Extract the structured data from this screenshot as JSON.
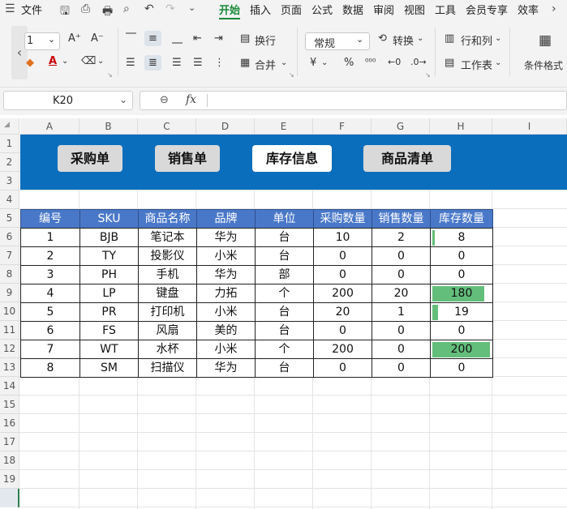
{
  "menu": {
    "file": "文件",
    "tabs": [
      "开始",
      "插入",
      "页面",
      "公式",
      "数据",
      "审阅",
      "视图",
      "工具",
      "会员专享",
      "效率"
    ]
  },
  "ribbon": {
    "font_size_value": "1",
    "wrap": "换行",
    "merge": "合并",
    "number_format": "常规",
    "convert": "转换",
    "rows_cols": "行和列",
    "worksheet": "工作表",
    "conditional_format": "条件格式"
  },
  "formula": {
    "namebox": "K20",
    "fx": "fx",
    "value": ""
  },
  "columns": [
    "A",
    "B",
    "C",
    "D",
    "E",
    "F",
    "G",
    "H",
    "I"
  ],
  "rows": [
    "1",
    "2",
    "3",
    "4",
    "5",
    "6",
    "7",
    "8",
    "9",
    "10",
    "11",
    "12",
    "13",
    "14",
    "15",
    "16",
    "17",
    "18",
    "19",
    "20"
  ],
  "nav_buttons": [
    "采购单",
    "销售单",
    "库存信息",
    "商品清单"
  ],
  "table": {
    "headers": [
      "编号",
      "SKU",
      "商品名称",
      "品牌",
      "单位",
      "采购数量",
      "销售数量",
      "库存数量"
    ],
    "rows": [
      [
        "1",
        "BJB",
        "笔记本",
        "华为",
        "台",
        "10",
        "2",
        "8"
      ],
      [
        "2",
        "TY",
        "投影仪",
        "小米",
        "台",
        "0",
        "0",
        "0"
      ],
      [
        "3",
        "PH",
        "手机",
        "华为",
        "部",
        "0",
        "0",
        "0"
      ],
      [
        "4",
        "LP",
        "键盘",
        "力拓",
        "个",
        "200",
        "20",
        "180"
      ],
      [
        "5",
        "PR",
        "打印机",
        "小米",
        "台",
        "20",
        "1",
        "19"
      ],
      [
        "6",
        "FS",
        "风扇",
        "美的",
        "台",
        "0",
        "0",
        "0"
      ],
      [
        "7",
        "WT",
        "水杯",
        "小米",
        "个",
        "200",
        "0",
        "200"
      ],
      [
        "8",
        "SM",
        "扫描仪",
        "华为",
        "台",
        "0",
        "0",
        "0"
      ]
    ],
    "databar_max": 200,
    "databar_color": "#63be7b",
    "header_color": "#4a78c8"
  },
  "colors": {
    "banner": "#0a6ebd",
    "accent": "#1a8a3a"
  }
}
